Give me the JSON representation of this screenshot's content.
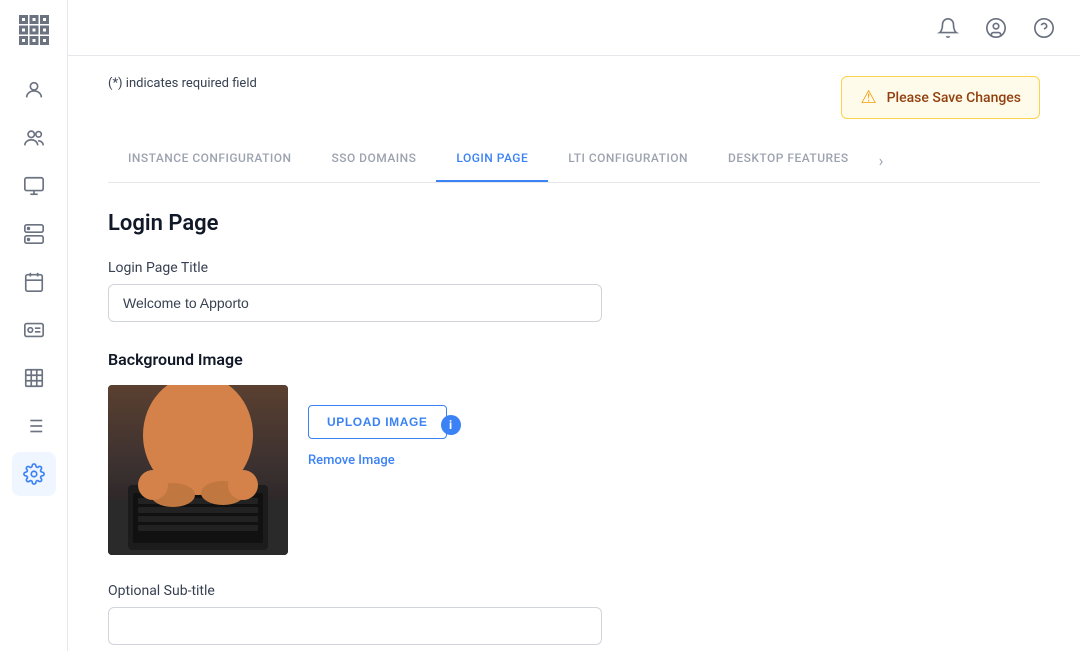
{
  "sidebar": {
    "items": [
      {
        "name": "grid",
        "icon": "grid",
        "active": false
      },
      {
        "name": "user",
        "icon": "user",
        "active": false
      },
      {
        "name": "users",
        "icon": "users",
        "active": false
      },
      {
        "name": "monitor",
        "icon": "monitor",
        "active": false
      },
      {
        "name": "server",
        "icon": "server",
        "active": false
      },
      {
        "name": "calendar",
        "icon": "calendar",
        "active": false
      },
      {
        "name": "id-card",
        "icon": "id-card",
        "active": false
      },
      {
        "name": "table",
        "icon": "table",
        "active": false
      },
      {
        "name": "list",
        "icon": "list",
        "active": false
      },
      {
        "name": "settings",
        "icon": "settings",
        "active": true
      }
    ]
  },
  "topbar": {
    "icons": [
      "bell",
      "user-circle",
      "question-circle"
    ]
  },
  "header": {
    "required_note": "(*) indicates required field",
    "alert": {
      "message": "Please Save Changes"
    }
  },
  "tabs": [
    {
      "label": "INSTANCE CONFIGURATION",
      "active": false
    },
    {
      "label": "SSO DOMAINS",
      "active": false
    },
    {
      "label": "LOGIN PAGE",
      "active": true
    },
    {
      "label": "LTI CONFIGURATION",
      "active": false
    },
    {
      "label": "DESKTOP FEATURES",
      "active": false
    }
  ],
  "page": {
    "title": "Login Page",
    "login_page_title_label": "Login Page Title",
    "login_page_title_value": "Welcome to Apporto",
    "background_image_label": "Background Image",
    "upload_button_label": "UPLOAD IMAGE",
    "remove_link_label": "Remove Image",
    "optional_subtitle_label": "Optional Sub-title",
    "optional_subtitle_value": ""
  }
}
